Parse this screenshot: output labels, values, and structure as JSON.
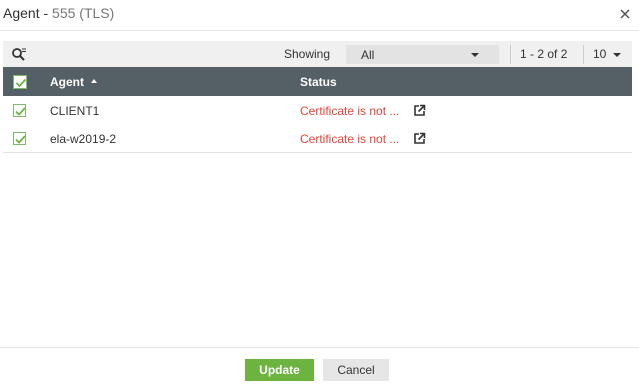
{
  "dialog": {
    "title": "Agent -",
    "title_sub": "555  (TLS)",
    "close_icon": "close-icon"
  },
  "filter": {
    "search_icon": "search-filter-icon",
    "showing_label": "Showing",
    "showing_value": "All",
    "pager_text": "1 - 2 of 2",
    "page_size": "10"
  },
  "table": {
    "columns": {
      "agent": "Agent",
      "status": "Status"
    },
    "rows": [
      {
        "agent": "CLIENT1",
        "status": "Certificate is not ...",
        "checked": true
      },
      {
        "agent": "ela-w2019-2",
        "status": "Certificate is not ...",
        "checked": true
      }
    ]
  },
  "footer": {
    "update_label": "Update",
    "cancel_label": "Cancel"
  },
  "colors": {
    "header_bg": "#555f66",
    "status_error": "#e0443a",
    "update_button": "#6cb33f",
    "check_green": "#6cb33f"
  }
}
